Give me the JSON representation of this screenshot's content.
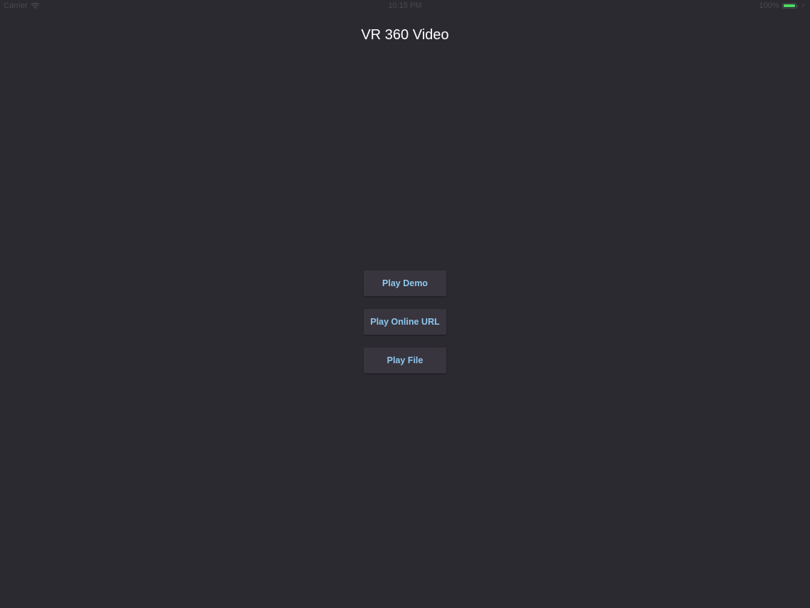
{
  "status_bar": {
    "carrier": "Carrier",
    "time": "10:15 PM",
    "battery": "100%",
    "battery_level": 1.0,
    "wifi_icon": "wifi-icon",
    "battery_icon": "battery-icon",
    "charging_icon": "bolt-icon"
  },
  "header": {
    "title": "VR 360 Video"
  },
  "actions": {
    "play_demo": "Play Demo",
    "play_online_url": "Play Online URL",
    "play_file": "Play File"
  },
  "colors": {
    "background": "#2b2a31",
    "button_background": "#38353e",
    "button_text": "#8fc7ef",
    "title_text": "#ffffff",
    "battery_green": "#4cd964"
  }
}
